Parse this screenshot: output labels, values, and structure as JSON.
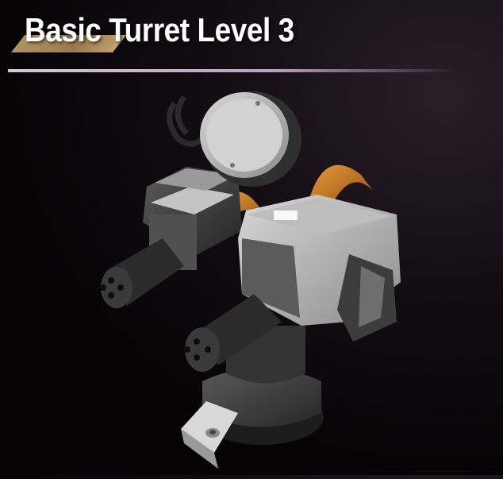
{
  "header": {
    "title": "Basic Turret Level 3"
  },
  "turret": {
    "icon": "turret-model-icon",
    "colors": {
      "metal_light": "#c9c9c9",
      "metal_dark": "#3d3d3d",
      "cable": "#d68a2c",
      "accent": "#b89a68",
      "divider": "#d9c6d9"
    }
  }
}
